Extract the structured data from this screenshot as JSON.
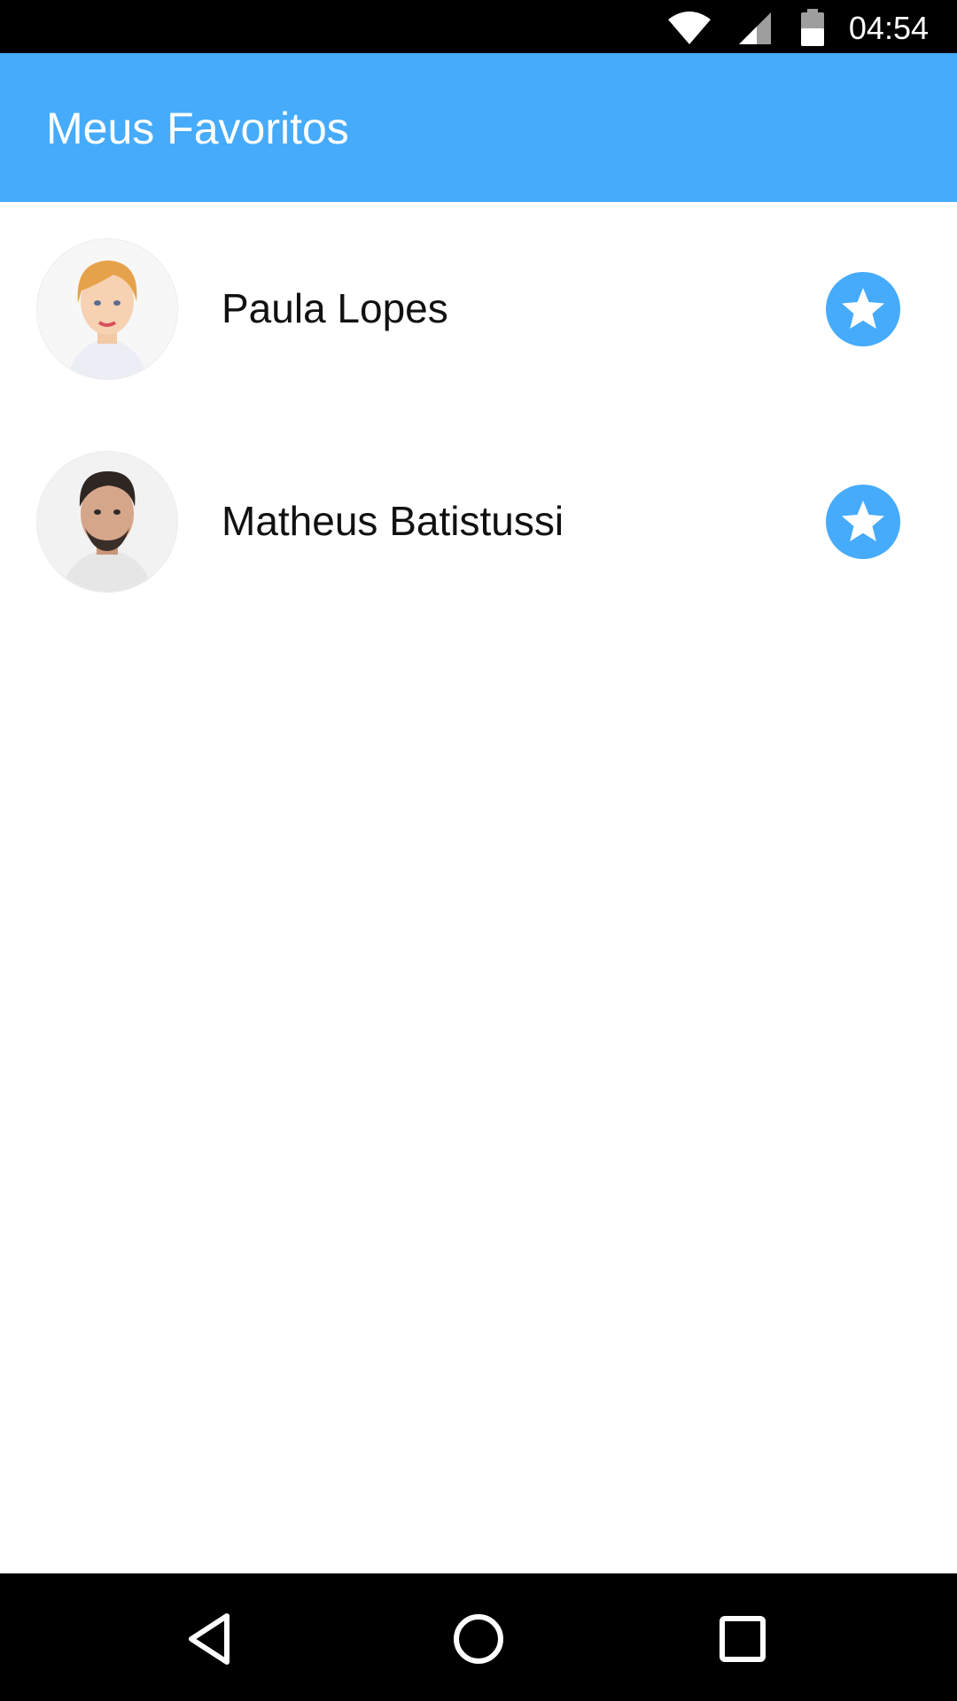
{
  "status_bar": {
    "time": "04:54",
    "icons": [
      "wifi-icon",
      "cell-signal-icon",
      "battery-icon"
    ]
  },
  "app_bar": {
    "title": "Meus Favoritos"
  },
  "favorites": [
    {
      "name": "Paula Lopes",
      "avatar": "avatar-woman-blonde",
      "action_icon": "star-icon"
    },
    {
      "name": "Matheus Batistussi",
      "avatar": "avatar-man-beard",
      "action_icon": "star-icon"
    }
  ],
  "nav_bar": {
    "icons": [
      "back-icon",
      "home-icon",
      "recents-icon"
    ]
  },
  "colors": {
    "accent": "#46abfb",
    "status_bar": "#000000",
    "nav_bar": "#000000",
    "background": "#ffffff",
    "text": "#111111"
  }
}
